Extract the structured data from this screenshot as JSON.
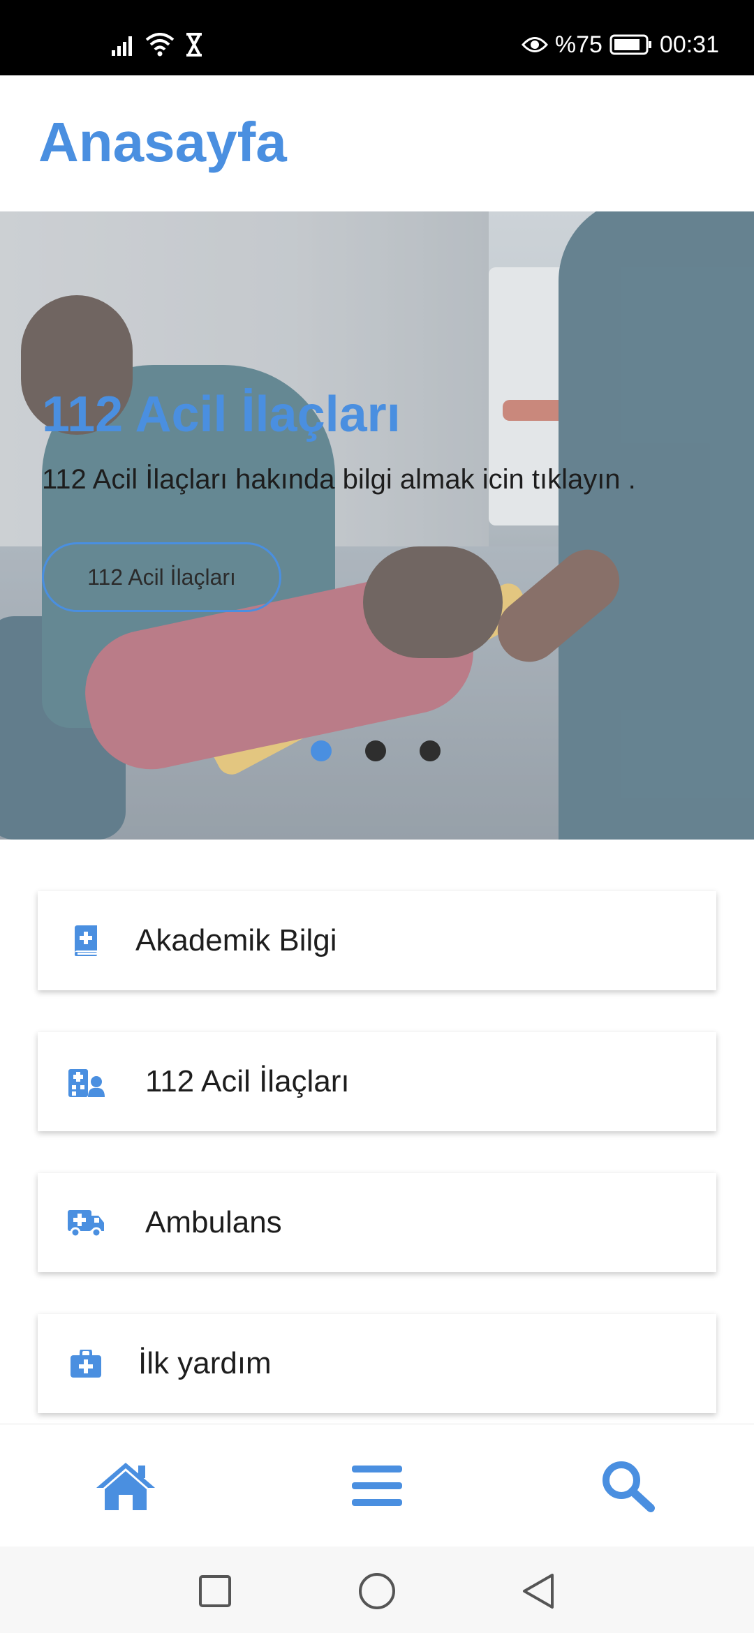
{
  "status_bar": {
    "battery_text": "%75",
    "time": "00:31"
  },
  "header": {
    "title": "Anasayfa"
  },
  "hero": {
    "title": "112 Acil İlaçları",
    "description": "112 Acil İlaçları hakında bilgi almak icin tıklayın .",
    "button_label": "112 Acil İlaçları",
    "active_slide": 1,
    "slide_count": 3
  },
  "menu": {
    "items": [
      {
        "label": "Akademik Bilgi",
        "icon": "medical-book-icon"
      },
      {
        "label": "112 Acil İlaçları",
        "icon": "hospital-user-icon"
      },
      {
        "label": "Ambulans",
        "icon": "ambulance-icon"
      },
      {
        "label": "İlk yardım",
        "icon": "first-aid-kit-icon"
      }
    ]
  },
  "bottom_nav": {
    "items": [
      "home-icon",
      "menu-icon",
      "search-icon"
    ]
  },
  "colors": {
    "accent": "#4a8fe0",
    "text": "#1d1d1d"
  }
}
